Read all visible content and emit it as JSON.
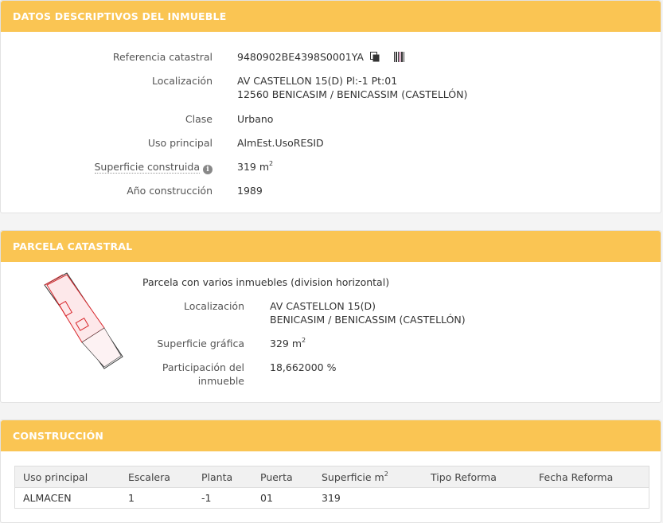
{
  "inmueble": {
    "title": "DATOS DESCRIPTIVOS DEL INMUEBLE",
    "ref_label": "Referencia catastral",
    "ref_value": "9480902BE4398S0001YA",
    "loc_label": "Localización",
    "loc_line1": "AV CASTELLON 15(D) Pl:-1 Pt:01",
    "loc_line2": "12560 BENICASIM / BENICASSIM (CASTELLÓN)",
    "clase_label": "Clase",
    "clase_value": "Urbano",
    "uso_label": "Uso principal",
    "uso_value": "AlmEst.UsoRESID",
    "sup_label": "Superficie construida",
    "sup_value": "319 m",
    "sup_unit_exp": "2",
    "anio_label": "Año construcción",
    "anio_value": "1989"
  },
  "parcela": {
    "title": "PARCELA CATASTRAL",
    "desc": "Parcela con varios inmuebles (division horizontal)",
    "loc_label": "Localización",
    "loc_line1": "AV CASTELLON 15(D)",
    "loc_line2": "BENICASIM / BENICASSIM (CASTELLÓN)",
    "sup_label": "Superficie gráfica",
    "sup_value": "329 m",
    "sup_unit_exp": "2",
    "part_label_1": "Participación del",
    "part_label_2": "inmueble",
    "part_value": "18,662000 %"
  },
  "construccion": {
    "title": "CONSTRUCCIÓN",
    "headers": [
      "Uso principal",
      "Escalera",
      "Planta",
      "Puerta",
      "Superficie m",
      "Tipo Reforma",
      "Fecha Reforma"
    ],
    "sup_header_exp": "2",
    "rows": [
      [
        "ALMACEN",
        "1",
        "-1",
        "01",
        "319",
        "",
        ""
      ]
    ]
  },
  "icons": {
    "copy": "copy-icon",
    "barcode": "barcode-icon",
    "info": "info-icon"
  },
  "colors": {
    "header_bg": "#fac553",
    "parcel_stroke": "#d9262b"
  }
}
